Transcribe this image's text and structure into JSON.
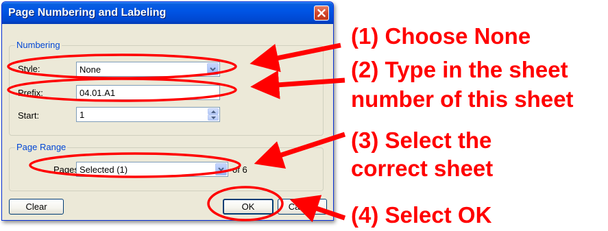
{
  "dialog": {
    "title": "Page Numbering and Labeling",
    "numbering": {
      "group_label": "Numbering",
      "style_label": "Style:",
      "style_value": "None",
      "prefix_label": "Prefix:",
      "prefix_value": "04.01.A1",
      "start_label": "Start:",
      "start_value": "1"
    },
    "page_range": {
      "group_label": "Page Range",
      "pages_label": "Pages",
      "pages_value": "Selected (1)",
      "of_text": "of 6"
    },
    "buttons": {
      "clear": "Clear",
      "ok": "OK",
      "cancel": "Cancel"
    }
  },
  "annotations": {
    "step1": "(1) Choose None",
    "step2_line1": "(2) Type in the sheet",
    "step2_line2": "number of this sheet",
    "step3_line1": "(3) Select the",
    "step3_line2": "correct sheet",
    "step4": "(4) Select OK"
  },
  "colors": {
    "annotation": "#ff0000",
    "title_bar": "#0055e5",
    "dialog_bg": "#ece9d8",
    "group_label": "#0046d5"
  }
}
